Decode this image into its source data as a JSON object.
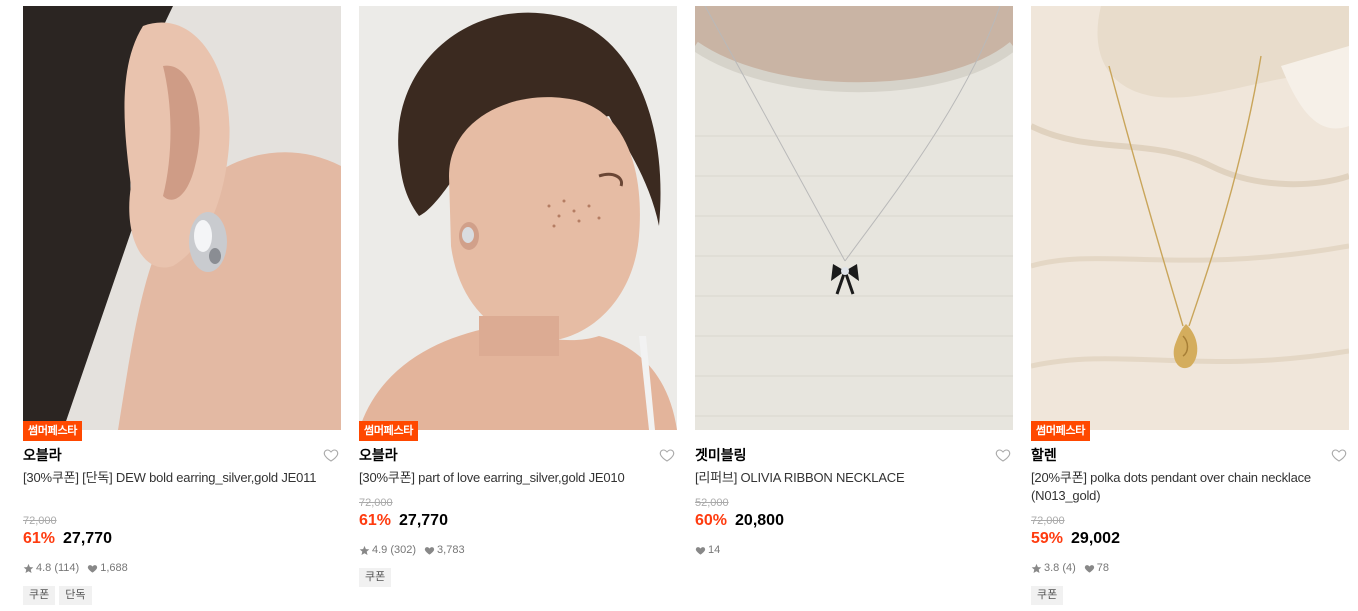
{
  "products": [
    {
      "badge": "썸머페스타",
      "brand": "오블라",
      "title": "[30%쿠폰] [단독] DEW bold earring_silver,gold JE011",
      "original_price": "72,000",
      "discount": "61%",
      "price": "27,770",
      "rating": "4.8 (114)",
      "likes": "1,688",
      "tags": [
        "쿠폰",
        "단독"
      ]
    },
    {
      "badge": "썸머페스타",
      "brand": "오블라",
      "title": "[30%쿠폰] part of love earring_silver,gold JE010",
      "original_price": "72,000",
      "discount": "61%",
      "price": "27,770",
      "rating": "4.9 (302)",
      "likes": "3,783",
      "tags": [
        "쿠폰"
      ]
    },
    {
      "badge": "",
      "brand": "겟미블링",
      "title": "[리퍼브] OLIVIA RIBBON NECKLACE",
      "original_price": "52,000",
      "discount": "60%",
      "price": "20,800",
      "rating": "",
      "likes": "14",
      "tags": []
    },
    {
      "badge": "썸머페스타",
      "brand": "할렌",
      "title": "[20%쿠폰] polka dots pendant over chain necklace (N013_gold)",
      "original_price": "72,000",
      "discount": "59%",
      "price": "29,002",
      "rating": "3.8 (4)",
      "likes": "78",
      "tags": [
        "쿠폰"
      ]
    }
  ],
  "colors": {
    "badge_bg": "#ff4800",
    "discount": "#ff3b0f",
    "price": "#000000"
  },
  "icons": {
    "wishlist": "heart-outline-icon",
    "rating": "star-icon",
    "likes": "heart-filled-icon"
  }
}
